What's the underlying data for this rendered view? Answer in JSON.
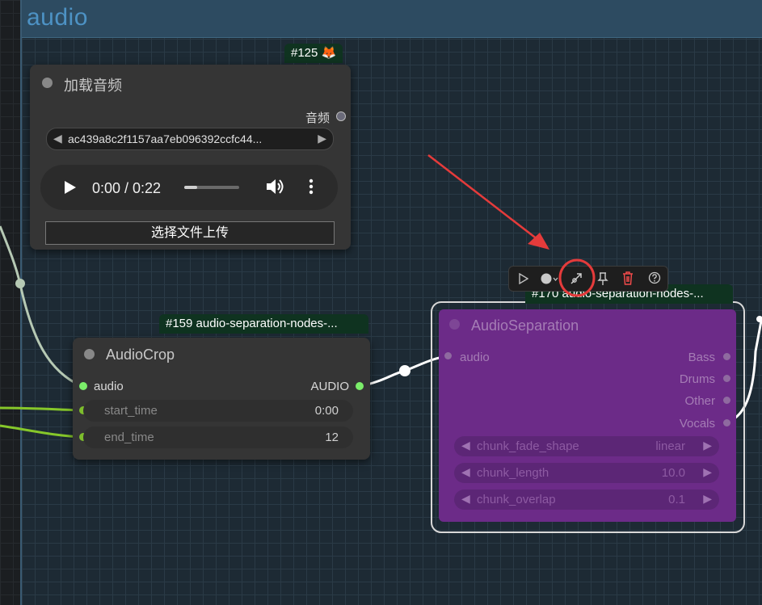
{
  "group": {
    "title": "audio"
  },
  "load_audio_node": {
    "badge": "#125 🦊",
    "title": "加载音频",
    "output_label": "音频",
    "file_combo": {
      "value": "ac439a8c2f1157aa7eb096392ccfc44...",
      "left_arrow": "◀",
      "right_arrow": "▶"
    },
    "player": {
      "time": "0:00 / 0:22",
      "progress_fraction": 0.0
    },
    "upload_label": "选择文件上传"
  },
  "audio_crop_node": {
    "badge": "#159 audio-separation-nodes-...",
    "title": "AudioCrop",
    "input_label": "audio",
    "output_label": "AUDIO",
    "widgets": [
      {
        "label": "start_time",
        "value": "0:00"
      },
      {
        "label": "end_time",
        "value": "12"
      }
    ]
  },
  "audio_separation_node": {
    "badge": "#170 audio-separation-nodes-...",
    "title": "AudioSeparation",
    "input_label": "audio",
    "outputs": [
      "Bass",
      "Drums",
      "Other",
      "Vocals"
    ],
    "widgets": [
      {
        "label": "chunk_fade_shape",
        "value": "linear"
      },
      {
        "label": "chunk_length",
        "value": "10.0"
      },
      {
        "label": "chunk_overlap",
        "value": "0.1"
      }
    ]
  },
  "node_toolbar": {
    "buttons": [
      "play-icon",
      "color-icon",
      "bypass-icon",
      "pin-icon",
      "delete-icon",
      "help-icon"
    ]
  },
  "colors": {
    "audio_slot": "#7bee6a",
    "wire_lime": "#86c72a",
    "wire_white": "#ffffff",
    "badge_bg": "#0f3320",
    "annotation_red": "#e53b3b",
    "separation_node_bg": "#6c2b88"
  }
}
